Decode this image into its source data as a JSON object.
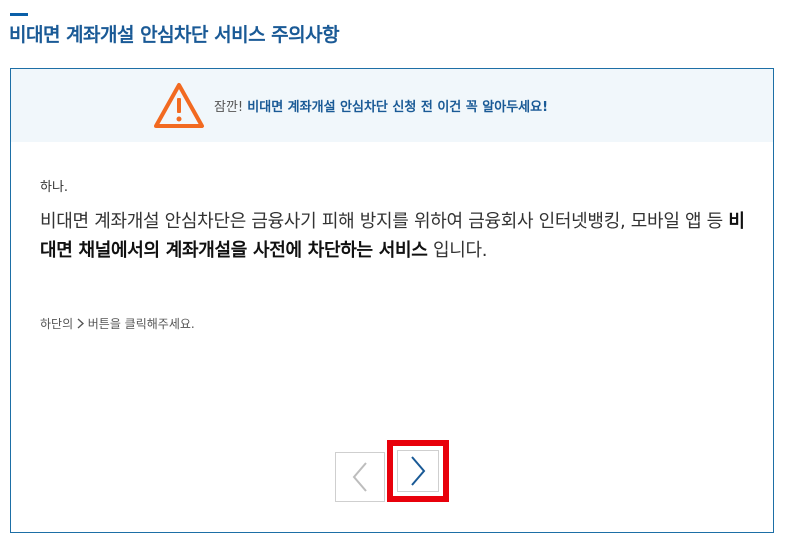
{
  "page": {
    "title": "비대면 계좌개설 안심차단 서비스 주의사항"
  },
  "banner": {
    "lead": "잠깐!",
    "highlight": "비대면 계좌개설 안심차단 신청 전 이건 꼭 알아두세요!"
  },
  "content": {
    "step_label": "하나.",
    "description_part1": "비대면 계좌개설 안심차단은 금융사기 피해 방지를 위하여 금융회사 인터넷뱅킹, 모바일 앱 등 ",
    "description_bold": "비대면 채널에서의 계좌개설을 사전에 차단하는 서비스",
    "description_part2": " 입니다.",
    "hint_before": "하단의 ",
    "hint_after": " 버튼을 클릭해주세요."
  },
  "colors": {
    "accent": "#1a5a96",
    "warning": "#f26a21",
    "highlight_border": "#e8000b"
  },
  "icons": {
    "warning": "warning-triangle-icon",
    "prev": "chevron-left-icon",
    "next": "chevron-right-icon"
  }
}
